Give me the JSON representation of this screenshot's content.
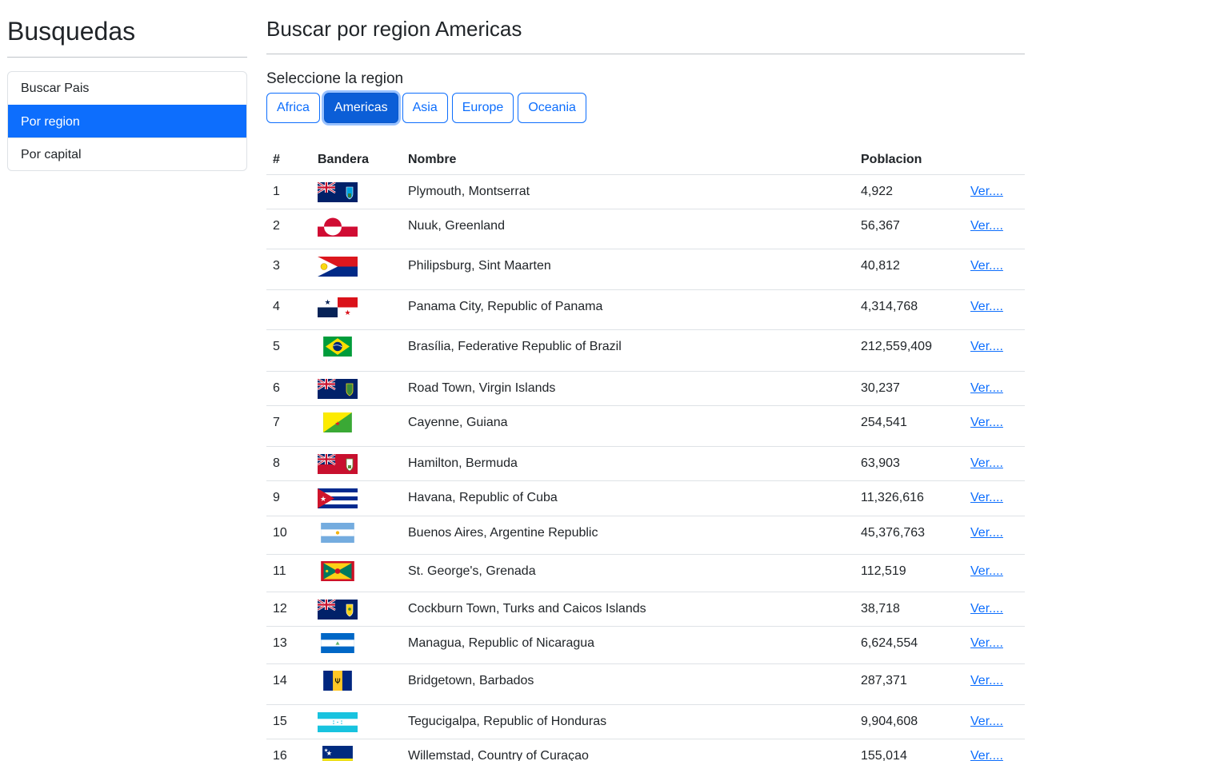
{
  "sidebar": {
    "title": "Busquedas",
    "items": [
      {
        "label": "Buscar Pais",
        "active": false
      },
      {
        "label": "Por region",
        "active": true
      },
      {
        "label": "Por capital",
        "active": false
      }
    ]
  },
  "main": {
    "title": "Buscar por region Americas",
    "subtitle": "Seleccione la region",
    "regions": [
      {
        "label": "Africa",
        "active": false
      },
      {
        "label": "Americas",
        "active": true
      },
      {
        "label": "Asia",
        "active": false
      },
      {
        "label": "Europe",
        "active": false
      },
      {
        "label": "Oceania",
        "active": false
      }
    ],
    "table": {
      "headers": {
        "num": "#",
        "flag": "Bandera",
        "name": "Nombre",
        "population": "Poblacion"
      },
      "link_label": "Ver....",
      "rows": [
        {
          "num": "1",
          "name": "Plymouth, Montserrat",
          "population": "4,922",
          "flag": "montserrat-flag"
        },
        {
          "num": "2",
          "name": "Nuuk, Greenland",
          "population": "56,367",
          "flag": "greenland-flag"
        },
        {
          "num": "3",
          "name": "Philipsburg, Sint Maarten",
          "population": "40,812",
          "flag": "sint-maarten-flag"
        },
        {
          "num": "4",
          "name": "Panama City, Republic of Panama",
          "population": "4,314,768",
          "flag": "panama-flag"
        },
        {
          "num": "5",
          "name": "Brasília, Federative Republic of Brazil",
          "population": "212,559,409",
          "flag": "brazil-flag"
        },
        {
          "num": "6",
          "name": "Road Town, Virgin Islands",
          "population": "30,237",
          "flag": "virgin-islands-flag"
        },
        {
          "num": "7",
          "name": "Cayenne, Guiana",
          "population": "254,541",
          "flag": "french-guiana-flag"
        },
        {
          "num": "8",
          "name": "Hamilton, Bermuda",
          "population": "63,903",
          "flag": "bermuda-flag"
        },
        {
          "num": "9",
          "name": "Havana, Republic of Cuba",
          "population": "11,326,616",
          "flag": "cuba-flag"
        },
        {
          "num": "10",
          "name": "Buenos Aires, Argentine Republic",
          "population": "45,376,763",
          "flag": "argentina-flag"
        },
        {
          "num": "11",
          "name": "St. George's, Grenada",
          "population": "112,519",
          "flag": "grenada-flag"
        },
        {
          "num": "12",
          "name": "Cockburn Town, Turks and Caicos Islands",
          "population": "38,718",
          "flag": "turks-caicos-flag"
        },
        {
          "num": "13",
          "name": "Managua, Republic of Nicaragua",
          "population": "6,624,554",
          "flag": "nicaragua-flag"
        },
        {
          "num": "14",
          "name": "Bridgetown, Barbados",
          "population": "287,371",
          "flag": "barbados-flag"
        },
        {
          "num": "15",
          "name": "Tegucigalpa, Republic of Honduras",
          "population": "9,904,608",
          "flag": "honduras-flag"
        },
        {
          "num": "16",
          "name": "Willemstad, Country of Curaçao",
          "population": "155,014",
          "flag": "curacao-flag"
        }
      ]
    }
  }
}
